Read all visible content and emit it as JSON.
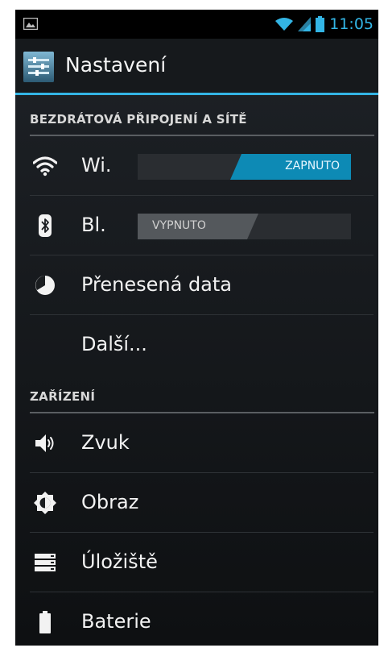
{
  "status_bar": {
    "time": "11:05",
    "icons": [
      "image-notification-icon",
      "wifi-signal-icon",
      "cell-signal-icon",
      "battery-icon"
    ],
    "accent_color": "#33b5e5"
  },
  "action_bar": {
    "title": "Nastavení",
    "icon": "settings-app-icon"
  },
  "sections": {
    "wireless": {
      "header": "BEZDRÁTOVÁ PŘIPOJENÍ A SÍTĚ"
    },
    "device": {
      "header": "ZAŘÍZENÍ"
    }
  },
  "items": {
    "wifi": {
      "label": "Wi.",
      "icon": "wifi-icon",
      "toggle": "ZAPNUTO",
      "state": "on"
    },
    "bluetooth": {
      "label": "Bl.",
      "icon": "bluetooth-icon",
      "toggle": "VYPNUTO",
      "state": "off"
    },
    "data_usage": {
      "label": "Přenesená data",
      "icon": "data-usage-icon"
    },
    "more": {
      "label": "Další..."
    },
    "sound": {
      "label": "Zvuk",
      "icon": "sound-icon"
    },
    "display": {
      "label": "Obraz",
      "icon": "display-icon"
    },
    "storage": {
      "label": "Úložiště",
      "icon": "storage-icon"
    },
    "battery": {
      "label": "Baterie",
      "icon": "battery-icon"
    }
  },
  "colors": {
    "toggle_on": "#0d8ab5",
    "toggle_off": "#54585c",
    "accent": "#33b5e5"
  }
}
